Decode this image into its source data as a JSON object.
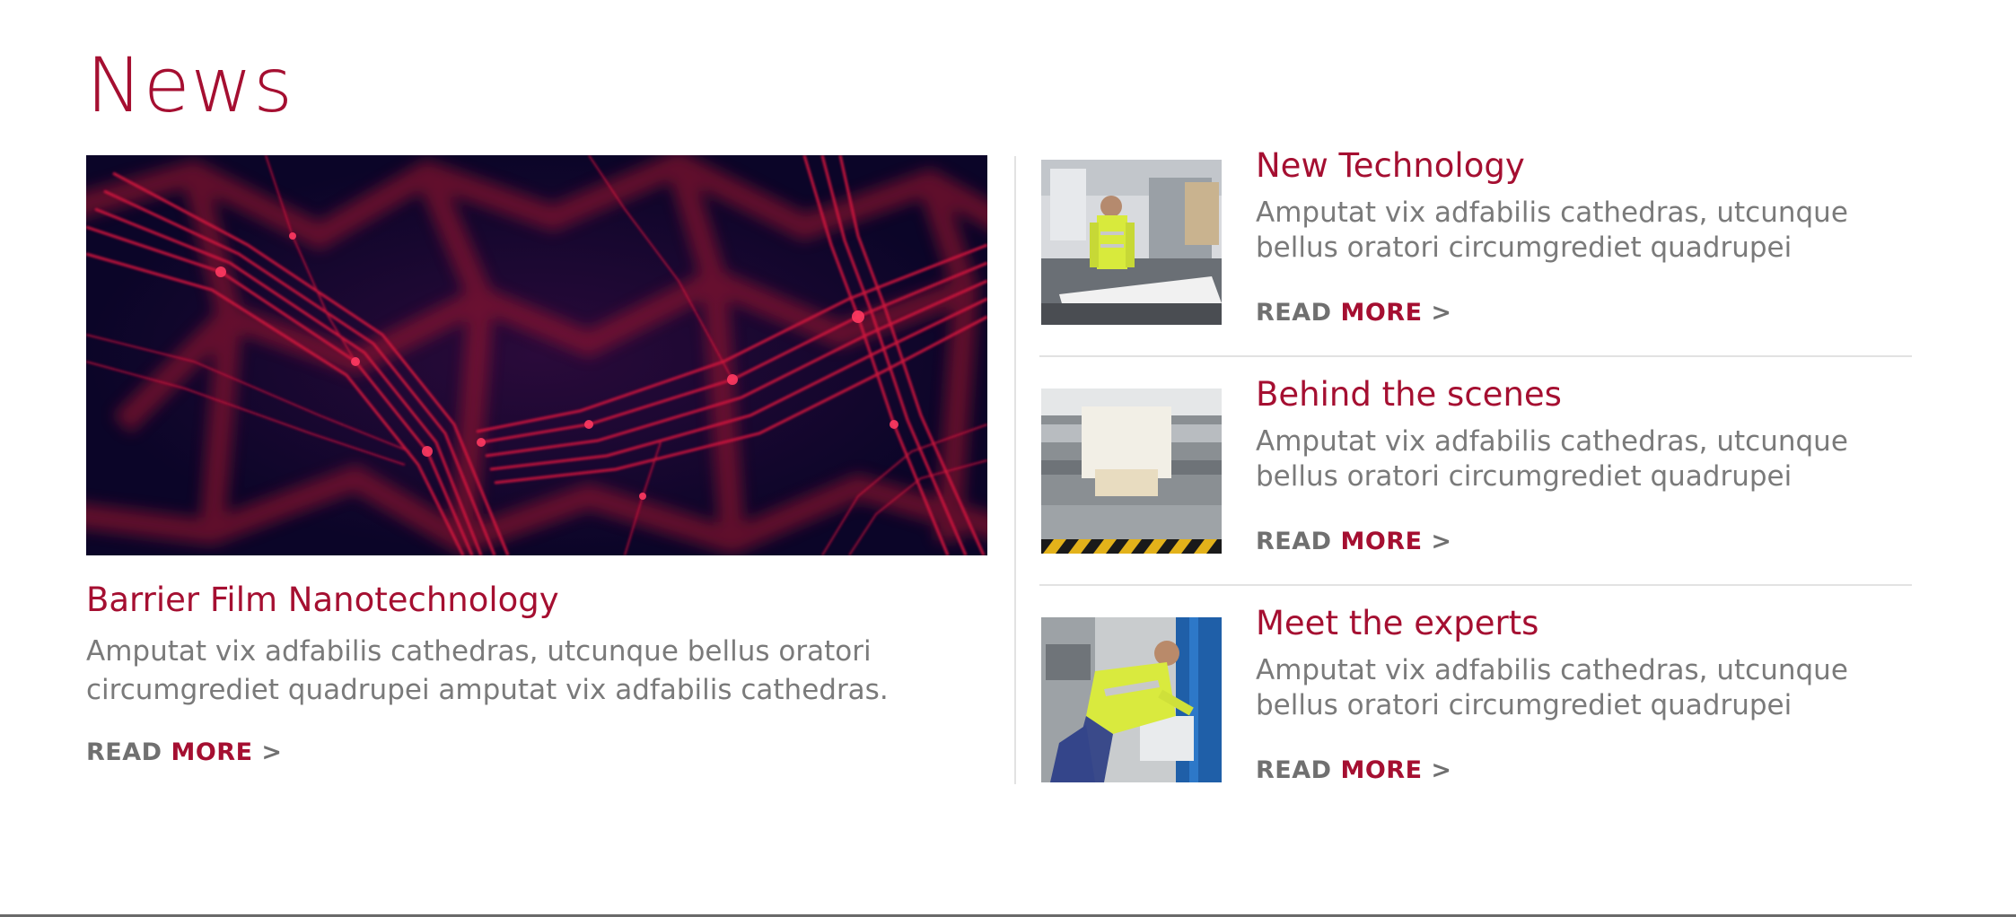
{
  "page": {
    "title": "News"
  },
  "featured": {
    "title": "Barrier Film Nanotechnology",
    "description": "Amputat vix adfabilis cathedras, utcunque bellus oratori circumgrediet quadrupei amputat vix adfabilis cathedras.",
    "read_more": {
      "read": "READ",
      "more": "MORE",
      "arrow": ">"
    }
  },
  "items": [
    {
      "title": "New Technology",
      "description": "Amputat vix adfabilis cathedras, utcunque bellus oratori circumgrediet quadrupei",
      "read_more": {
        "read": "READ",
        "more": "MORE",
        "arrow": ">"
      }
    },
    {
      "title": "Behind the scenes",
      "description": "Amputat vix adfabilis cathedras, utcunque bellus oratori circumgrediet quadrupei",
      "read_more": {
        "read": "READ",
        "more": "MORE",
        "arrow": ">"
      }
    },
    {
      "title": "Meet the experts",
      "description": "Amputat vix adfabilis cathedras, utcunque bellus oratori circumgrediet quadrupei",
      "read_more": {
        "read": "READ",
        "more": "MORE",
        "arrow": ">"
      }
    }
  ],
  "colors": {
    "accent": "#a50f31",
    "body_text": "#7a7a7a",
    "read_label": "#707070",
    "divider": "#e2e2e2",
    "image_dark": "#0d0630"
  }
}
